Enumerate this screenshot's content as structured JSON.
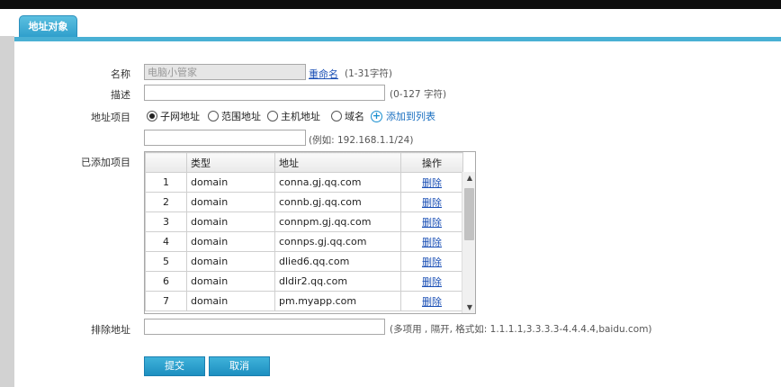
{
  "tab": {
    "label": "地址对象"
  },
  "form": {
    "name": {
      "label": "名称",
      "value": "电脑小管家",
      "rename_link": "重命名",
      "hint": "(1-31字符)"
    },
    "desc": {
      "label": "描述",
      "value": "",
      "hint": "(0-127 字符)"
    },
    "item": {
      "label": "地址项目",
      "options": [
        "子网地址",
        "范围地址",
        "主机地址",
        "域名"
      ],
      "selected": "子网地址",
      "add_label": "添加到列表",
      "input_value": "",
      "example": "(例如: 192.168.1.1/24)"
    },
    "added": {
      "label": "已添加项目",
      "columns": [
        "类型",
        "地址",
        "操作"
      ],
      "rows": [
        {
          "num": "1",
          "type": "domain",
          "addr": "conna.gj.qq.com",
          "op": "删除"
        },
        {
          "num": "2",
          "type": "domain",
          "addr": "connb.gj.qq.com",
          "op": "删除"
        },
        {
          "num": "3",
          "type": "domain",
          "addr": "connpm.gj.qq.com",
          "op": "删除"
        },
        {
          "num": "4",
          "type": "domain",
          "addr": "connps.gj.qq.com",
          "op": "删除"
        },
        {
          "num": "5",
          "type": "domain",
          "addr": "dlied6.qq.com",
          "op": "删除"
        },
        {
          "num": "6",
          "type": "domain",
          "addr": "dldir2.qq.com",
          "op": "删除"
        },
        {
          "num": "7",
          "type": "domain",
          "addr": "pm.myapp.com",
          "op": "删除"
        }
      ]
    },
    "exclude": {
      "label": "排除地址",
      "value": "",
      "hint": "(多项用 , 隔开, 格式如: 1.1.1.1,3.3.3.3-4.4.4.4,baidu.com)"
    }
  },
  "buttons": {
    "submit": "提交",
    "cancel": "取消"
  }
}
